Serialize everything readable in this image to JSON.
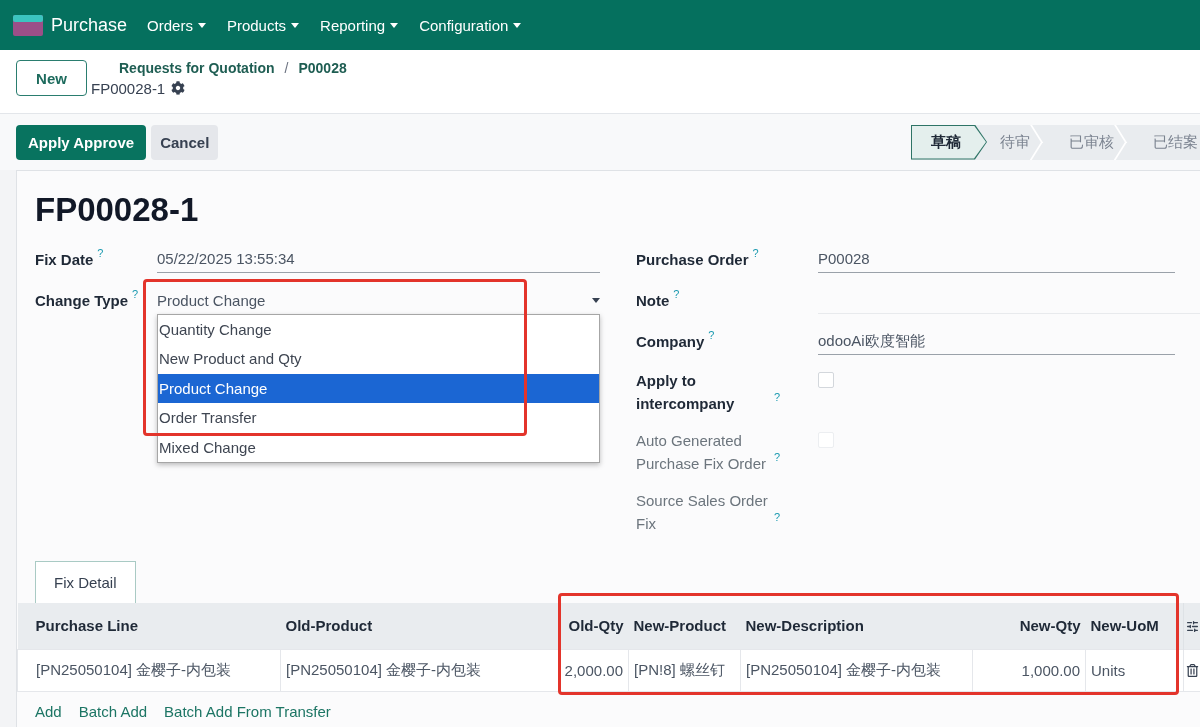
{
  "navbar": {
    "app": "Purchase",
    "menus": [
      {
        "label": "Orders"
      },
      {
        "label": "Products"
      },
      {
        "label": "Reporting"
      },
      {
        "label": "Configuration"
      }
    ]
  },
  "control_panel": {
    "new_button": "New",
    "breadcrumbs": [
      "Requests for Quotation",
      "P00028"
    ],
    "separator": "/",
    "record": "FP00028-1"
  },
  "action_bar": {
    "buttons": [
      {
        "label": "Apply Approve",
        "kind": "primary"
      },
      {
        "label": "Cancel",
        "kind": "secondary"
      }
    ],
    "stages": [
      {
        "label": "草稿",
        "selected": true
      },
      {
        "label": "待审",
        "selected": false
      },
      {
        "label": "已审核",
        "selected": false
      },
      {
        "label": "已结案",
        "selected": false
      }
    ]
  },
  "form": {
    "title": "FP00028-1",
    "left_fields": [
      {
        "label": "Fix Date",
        "help": "?",
        "kind": "text",
        "value": "05/22/2025 13:55:34",
        "disabled": false
      },
      {
        "label": "Change Type",
        "help": "?",
        "kind": "select",
        "value": "Product Change",
        "expanded": true,
        "highlighted": true,
        "disabled": false,
        "options": [
          {
            "label": "Quantity Change",
            "selected": false
          },
          {
            "label": "New Product and Qty",
            "selected": false
          },
          {
            "label": "Product Change",
            "selected": true
          },
          {
            "label": "Order Transfer",
            "selected": false
          },
          {
            "label": "Mixed Change",
            "selected": false
          }
        ]
      }
    ],
    "right_fields": [
      {
        "label": "Purchase Order",
        "help": "?",
        "kind": "text",
        "value": "P00028",
        "disabled": false
      },
      {
        "label": "Note",
        "help": "?",
        "kind": "textarea",
        "disabled": false
      },
      {
        "label": "Company",
        "help": "?",
        "kind": "text",
        "value": "odooAi欧度智能",
        "disabled": false
      },
      {
        "label": "Apply to intercompany",
        "help": "?",
        "kind": "checkbox",
        "checked": false,
        "disabled": false
      },
      {
        "label": "Auto Generated Purchase Fix Order",
        "help": "?",
        "kind": "checkbox",
        "checked": false,
        "disabled": true
      },
      {
        "label": "Source Sales Order Fix",
        "help": "?",
        "kind": "readonly",
        "disabled": true
      }
    ]
  },
  "tabs": [
    {
      "label": "Fix Detail",
      "selected": true
    }
  ],
  "table": {
    "highlighted": true,
    "columns": [
      {
        "label": "Purchase Line",
        "kind": "text"
      },
      {
        "label": "Old-Product",
        "kind": "text"
      },
      {
        "label": "Old-Qty",
        "kind": "number"
      },
      {
        "label": "New-Product",
        "kind": "text"
      },
      {
        "label": "New-Description",
        "kind": "text"
      },
      {
        "label": "New-Qty",
        "kind": "number"
      },
      {
        "label": "New-UoM",
        "kind": "text"
      }
    ],
    "rows": [
      {
        "cells": [
          "[PN25050104] 金樱子-内包装",
          "[PN25050104] 金樱子-内包装",
          "2,000.00",
          "[PN!8] 螺丝钉",
          "[PN25050104] 金樱子-内包装",
          "1,000.00",
          "Units"
        ]
      }
    ]
  },
  "row_links": [
    "Add",
    "Batch Add",
    "Batch Add From Transfer"
  ]
}
